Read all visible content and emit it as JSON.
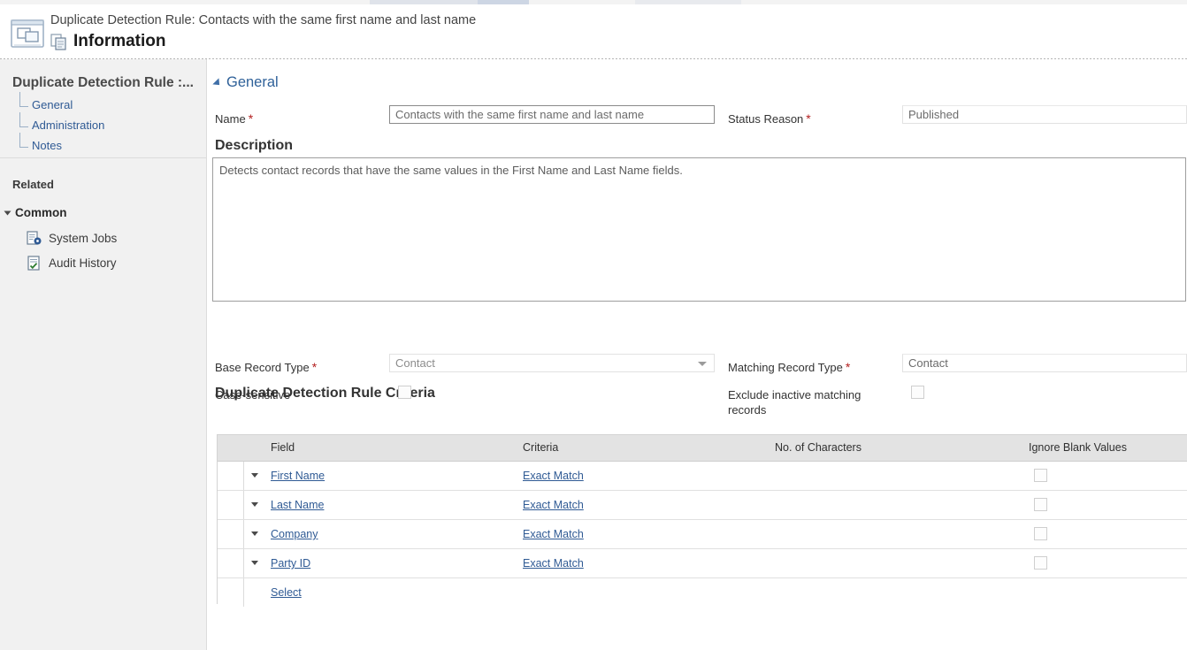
{
  "header": {
    "entity_icon": "duplicate-detection-rule-icon",
    "subtitle": "Duplicate Detection Rule: Contacts with the same first name and last name",
    "form_icon": "information-form-icon",
    "title": "Information"
  },
  "navpane": {
    "title": "Duplicate Detection Rule :...",
    "tree_items": [
      {
        "label": "General"
      },
      {
        "label": "Administration"
      },
      {
        "label": "Notes"
      }
    ],
    "related_header": "Related",
    "group": {
      "label": "Common",
      "caret_icon": "chevron-expanded-icon"
    },
    "related_items": [
      {
        "label": "System Jobs",
        "icon": "system-jobs-icon"
      },
      {
        "label": "Audit History",
        "icon": "audit-history-icon"
      }
    ]
  },
  "form": {
    "general_section": {
      "label": "General",
      "collapse_icon": "triangle-collapse-icon"
    },
    "name": {
      "label": "Name",
      "required": "*",
      "value": "Contacts with the same first name and last name",
      "placeholder": "Name"
    },
    "status_reason": {
      "label": "Status Reason",
      "required": "*",
      "value": "Published",
      "placeholder": "Status Reason"
    },
    "description": {
      "label": "Description",
      "value": "Detects contact records that have the same values in the First Name and Last Name fields.",
      "placeholder": "Description"
    },
    "criteria_section_title": "Duplicate Detection Rule Criteria",
    "base_record_type": {
      "label": "Base Record Type",
      "required": "*",
      "value": "Contact",
      "dropdown_icon": "chevron-down-icon"
    },
    "matching_record_type": {
      "label": "Matching Record Type",
      "required": "*",
      "value": "Contact"
    },
    "case_sensitive": {
      "label": "Case-sensitive",
      "checked": false
    },
    "exclude_inactive": {
      "label": "Exclude inactive matching records",
      "checked": false
    }
  },
  "criteria_grid": {
    "columns": [
      "Field",
      "Criteria",
      "No. of Characters",
      "Ignore Blank Values"
    ],
    "rows": [
      {
        "field": "First Name",
        "criteria": "Exact Match",
        "chars": "",
        "ignore_blank": false
      },
      {
        "field": "Last Name",
        "criteria": "Exact Match",
        "chars": "",
        "ignore_blank": false
      },
      {
        "field": "Company",
        "criteria": "Exact Match",
        "chars": "",
        "ignore_blank": false
      },
      {
        "field": "Party ID",
        "criteria": "Exact Match",
        "chars": "",
        "ignore_blank": false
      }
    ],
    "select_row_label": "Select"
  },
  "colors": {
    "link": "#2f5a94",
    "required_asterisk": "#b31e1e",
    "nav_background": "#f1f1f1",
    "grid_header": "#e3e3e3"
  }
}
